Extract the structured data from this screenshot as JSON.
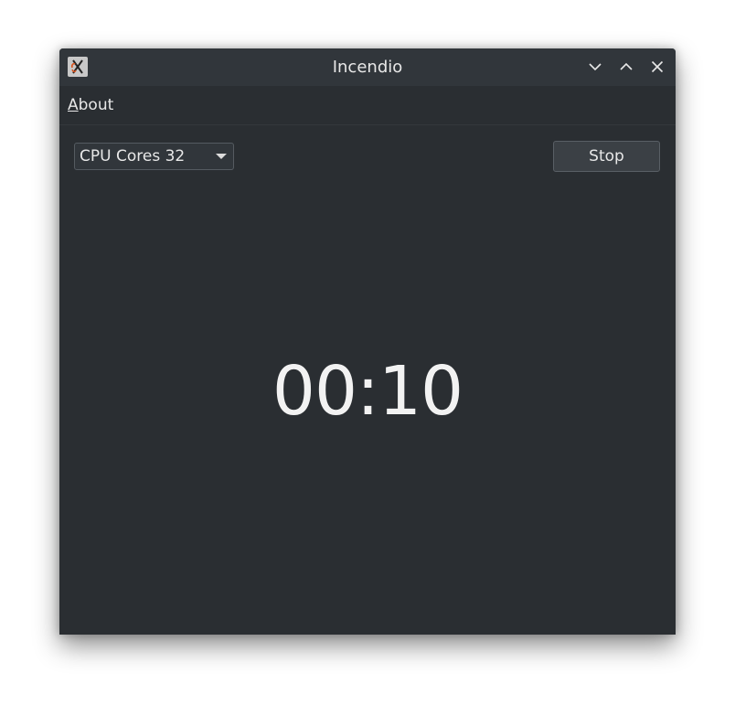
{
  "window": {
    "title": "Incendio",
    "app_icon": "incendio-app-icon",
    "controls": {
      "minimize_icon": "chevron-down-icon",
      "maximize_icon": "chevron-up-icon",
      "close_icon": "close-icon"
    }
  },
  "menubar": {
    "about_mnemonic": "A",
    "about_rest": "bout"
  },
  "controls": {
    "cores_select_value": "CPU Cores 32",
    "stop_label": "Stop"
  },
  "timer": {
    "display": "00:10"
  },
  "colors": {
    "background": "#2a2e32",
    "titlebar": "#31363b",
    "text": "#e8e8e8"
  }
}
